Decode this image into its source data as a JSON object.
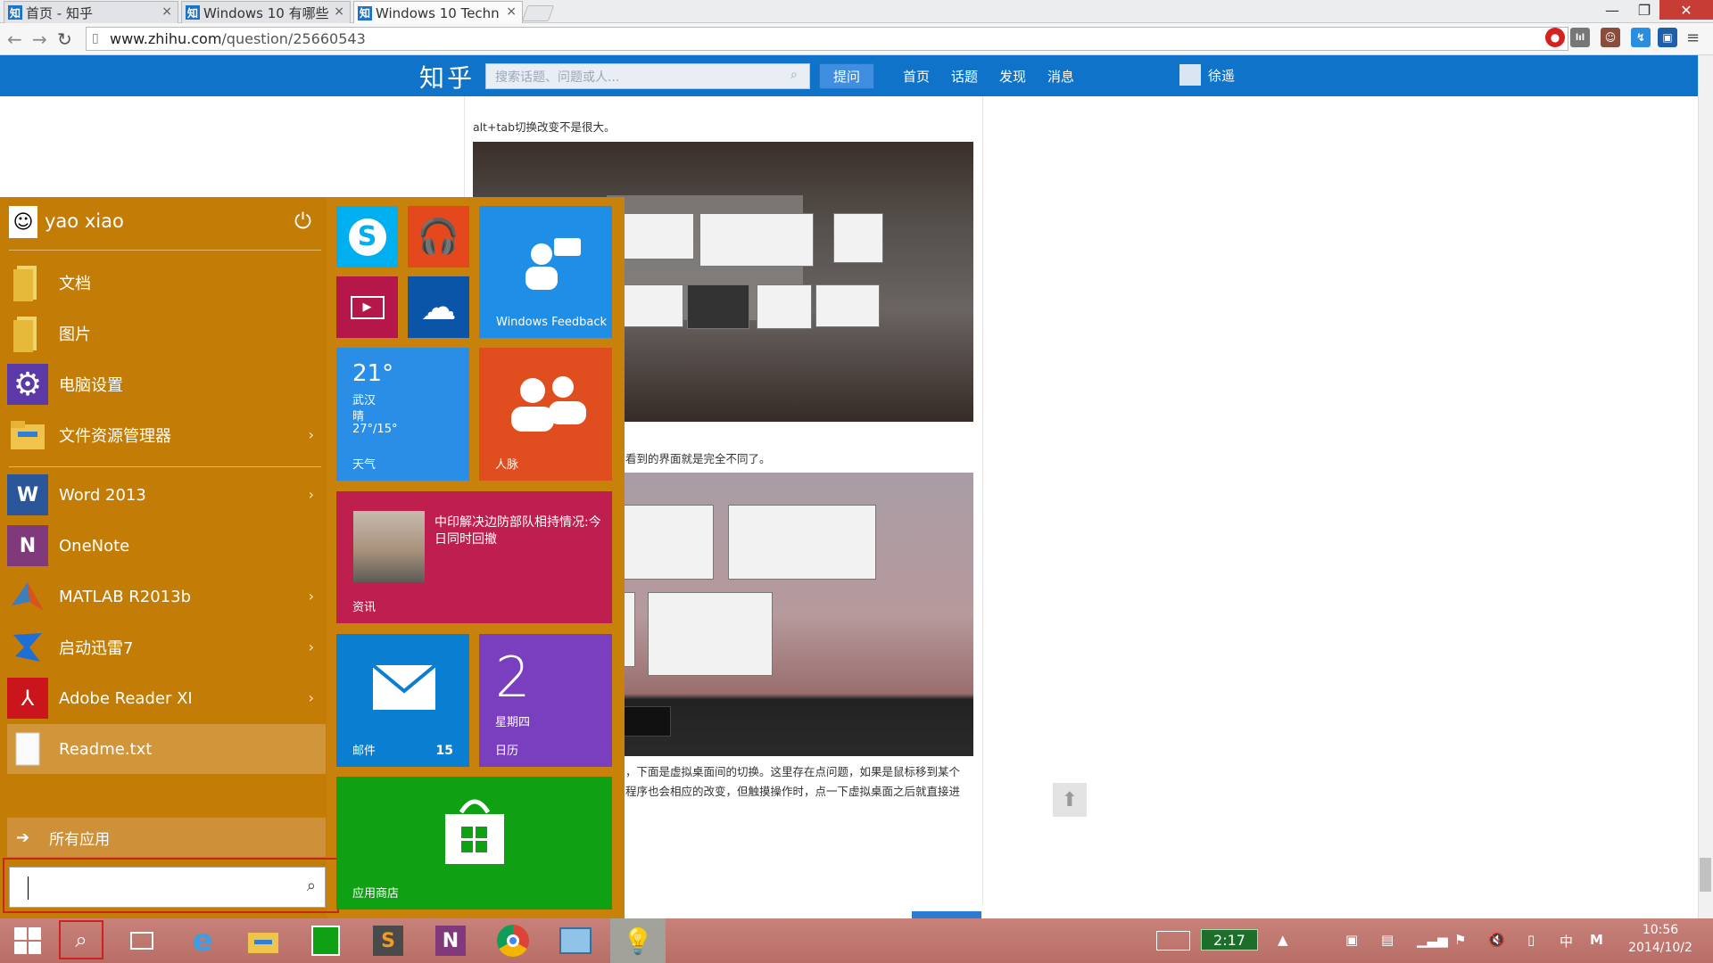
{
  "browser": {
    "tabs": [
      {
        "favicon": "知",
        "title": "首页 - 知乎"
      },
      {
        "favicon": "知",
        "title": "Windows 10 有哪些"
      },
      {
        "favicon": "知",
        "title": "Windows 10 Techn"
      }
    ],
    "url": "www.zhihu.com/question/25660543",
    "url_domain": "www.zhihu.com",
    "url_path": "/question/25660543"
  },
  "zhihu": {
    "logo": "知乎",
    "search_placeholder": "搜索话题、问题或人...",
    "ask_button": "提问",
    "nav": [
      "首页",
      "话题",
      "发现",
      "消息"
    ],
    "username": "徐遥"
  },
  "article": {
    "line1": "alt+tab切换改变不是很大。",
    "line2": "看到的界面就是完全不同了。",
    "line3": "，下面是虚拟桌面间的切换。这里存在点问题，如果是鼠标移到某个",
    "line4": "程序也会相应的改变，但触摸操作时，点一下虚拟桌面之后就直接进"
  },
  "start_menu": {
    "user_name": "yao xiao",
    "items": [
      {
        "label": "文档",
        "icon": "folder-icon",
        "arrow": false
      },
      {
        "label": "图片",
        "icon": "folder-icon",
        "arrow": false
      },
      {
        "label": "电脑设置",
        "icon": "gear-icon",
        "arrow": false
      },
      {
        "label": "文件资源管理器",
        "icon": "file-explorer-icon",
        "arrow": true
      },
      {
        "label": "Word 2013",
        "icon": "word-icon",
        "arrow": true
      },
      {
        "label": "OneNote",
        "icon": "onenote-icon",
        "arrow": false
      },
      {
        "label": "MATLAB R2013b",
        "icon": "matlab-icon",
        "arrow": true
      },
      {
        "label": "启动迅雷7",
        "icon": "thunder-icon",
        "arrow": true
      },
      {
        "label": "Adobe Reader XI",
        "icon": "adobe-reader-icon",
        "arrow": true
      },
      {
        "label": "Readme.txt",
        "icon": "text-file-icon",
        "arrow": false
      }
    ],
    "all_apps": "所有应用",
    "search_value": "",
    "tiles": {
      "windows_feedback": "Windows Feedback",
      "weather_temp": "21°",
      "weather_city": "武汉",
      "weather_cond": "晴",
      "weather_range": "27°/15°",
      "weather_label": "天气",
      "people_label": "人脉",
      "news_headline": "中印解决边防部队相持情况:今日同时回撤",
      "news_label": "资讯",
      "mail_label": "邮件",
      "mail_count": "15",
      "calendar_day": "2",
      "calendar_weekday": "星期四",
      "calendar_label": "日历",
      "store_label": "应用商店"
    }
  },
  "taskbar": {
    "battery_time": "2:17",
    "time": "10:56",
    "date": "2014/10/2",
    "ime": "中",
    "ime2": "M"
  },
  "colors": {
    "start_bg": "#c8820c",
    "zhihu_blue": "#0f73c9",
    "taskbar": "#b76e67"
  }
}
